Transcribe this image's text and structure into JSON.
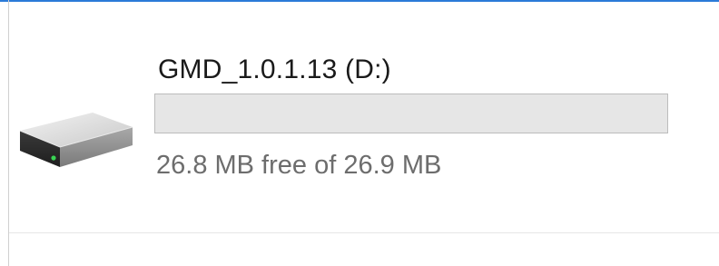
{
  "drive": {
    "name": "GMD_1.0.1.13 (D:)",
    "free_space_text": "26.8 MB free of 26.9 MB",
    "used_fraction": 0.0,
    "icon": "hard-drive-icon",
    "bar_color": "#e6e6e6",
    "bar_fill_color": "#26a0da",
    "accent_color": "#2b7bd8"
  }
}
